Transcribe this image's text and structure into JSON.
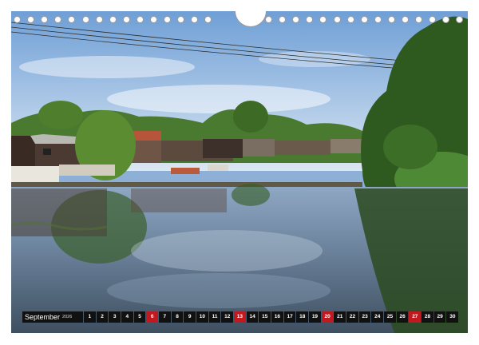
{
  "calendar": {
    "month": "September",
    "year": "2026",
    "days": [
      "1",
      "2",
      "3",
      "4",
      "5",
      "6",
      "7",
      "8",
      "9",
      "10",
      "11",
      "12",
      "13",
      "14",
      "15",
      "16",
      "17",
      "18",
      "19",
      "20",
      "21",
      "22",
      "23",
      "24",
      "25",
      "26",
      "27",
      "28",
      "29",
      "30"
    ],
    "highlight_days": [
      "6",
      "13",
      "20",
      "27"
    ],
    "highlight_color": "#c0191f",
    "bar_color": "#111111"
  },
  "binding": {
    "hole_count_left": 15,
    "hole_count_right": 15
  },
  "photo": {
    "description_icon": "canal-landscape-photo",
    "sky_color": "#8fb4dc",
    "water_color": "#5b6f84",
    "foliage_color": "#3f6a2a"
  }
}
